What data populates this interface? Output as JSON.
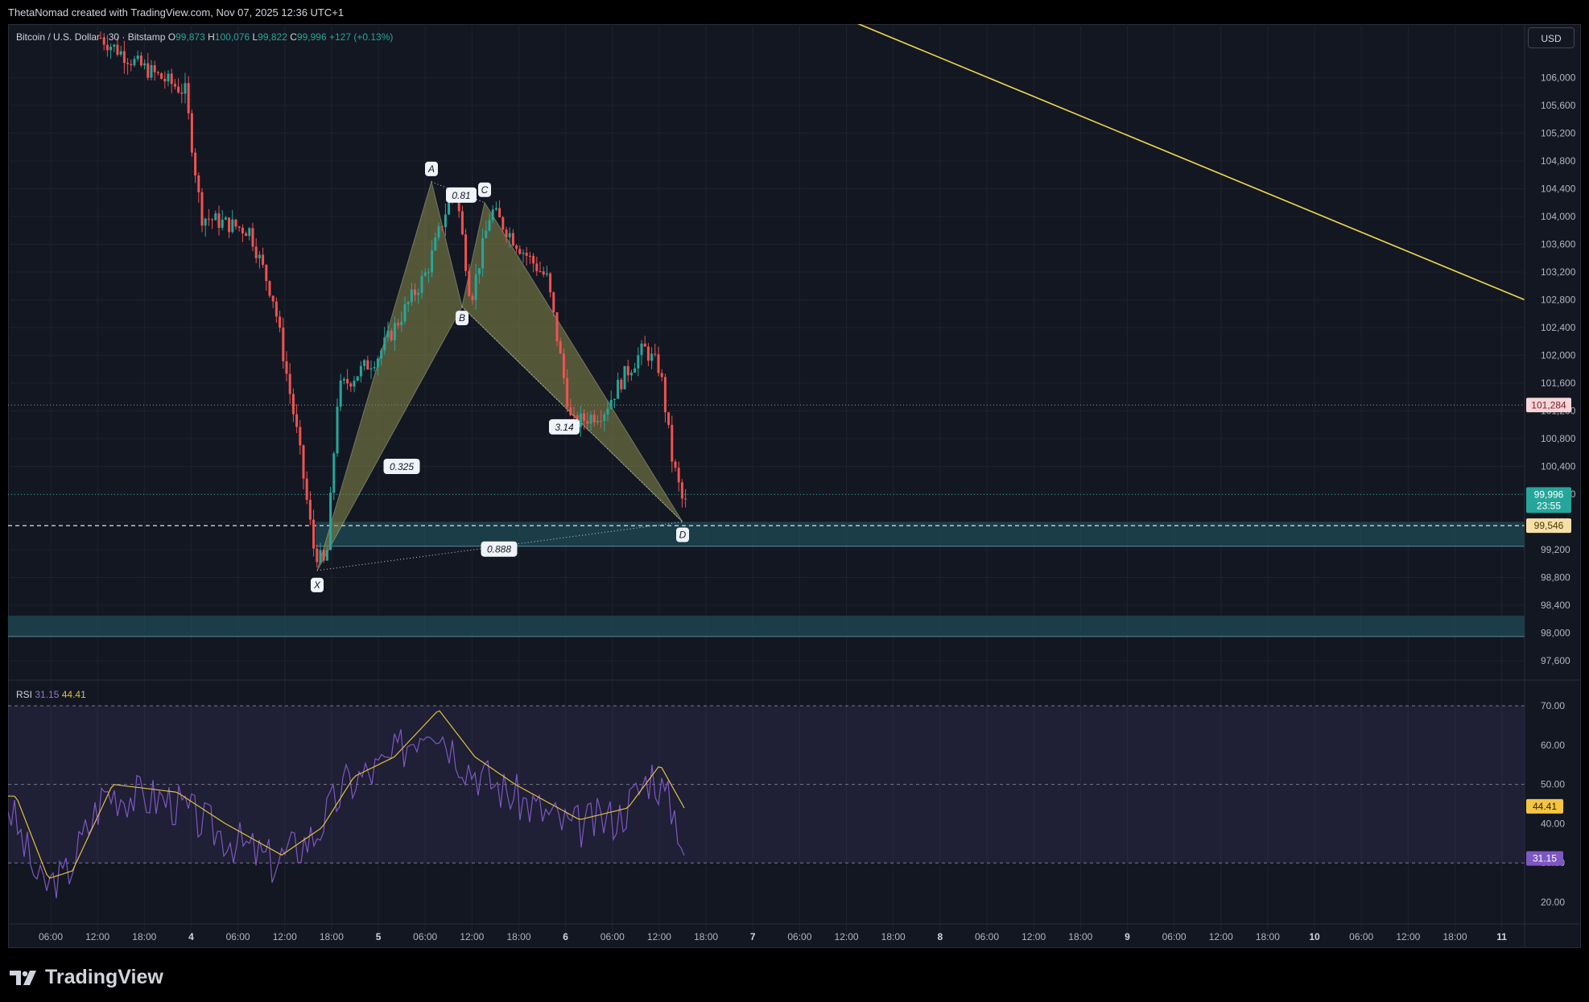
{
  "header": {
    "credit": "ThetaNomad created with TradingView.com, Nov 07, 2025 12:36 UTC+1",
    "symbol": "Bitcoin / U.S. Dollar · 30 · Bitstamp",
    "ohlc": {
      "o_label": "O",
      "o": "99,873",
      "h_label": "H",
      "h": "100,076",
      "l_label": "L",
      "l": "99,822",
      "c_label": "C",
      "c": "99,996",
      "change": "+127 (+0.13%)"
    },
    "currency": "USD"
  },
  "colors": {
    "bg": "#131722",
    "up": "#26a69a",
    "down": "#ef5350",
    "pattern_fill": "#8a8a4a",
    "trendline": "#f2d94e",
    "rsi": "#7e57c2",
    "rsi_ma": "#e0c040",
    "zone": "#1e4b55"
  },
  "chart_data": [
    {
      "type": "candlestick",
      "title": "Bitcoin / U.S. Dollar · 30 · Bitstamp",
      "y_ticks": [
        "106,000",
        "105,600",
        "105,200",
        "104,800",
        "104,400",
        "104,000",
        "103,600",
        "103,200",
        "102,800",
        "102,400",
        "102,000",
        "101,600",
        "101,200",
        "100,800",
        "100,400",
        "100,000",
        "99,600",
        "99,200",
        "98,800",
        "98,400",
        "98,000",
        "97,600"
      ],
      "ylim": [
        97350,
        106500
      ],
      "x_ticks": [
        "06:00",
        "12:00",
        "18:00",
        "4",
        "06:00",
        "12:00",
        "18:00",
        "5",
        "06:00",
        "12:00",
        "18:00",
        "6",
        "06:00",
        "12:00",
        "18:00",
        "7",
        "06:00",
        "12:00",
        "18:00",
        "8",
        "06:00",
        "12:00",
        "18:00",
        "9",
        "06:00",
        "12:00",
        "18:00",
        "10",
        "06:00",
        "12:00",
        "18:00",
        "11"
      ],
      "price_labels": {
        "marked_level": "101,284",
        "last_price": "99,996",
        "countdown": "23:55",
        "target_level": "99,546"
      },
      "harmonic_pattern": {
        "points": [
          {
            "label": "X",
            "price": 98900
          },
          {
            "label": "A",
            "price": 104500
          },
          {
            "label": "B",
            "price": 102700
          },
          {
            "label": "C",
            "price": 104200
          },
          {
            "label": "D",
            "price": 99600
          }
        ],
        "ratios": [
          "0.81",
          "0.325",
          "3.14",
          "0.888"
        ]
      },
      "zones": [
        {
          "from": 99250,
          "to": 99600
        },
        {
          "from": 97950,
          "to": 98250
        }
      ],
      "trendline": {
        "from_price": 107000,
        "to_price": 102800
      }
    },
    {
      "type": "line",
      "title": "RSI",
      "values_legend": {
        "rsi": "31.15",
        "ma": "44.41"
      },
      "y_ticks": [
        "70.00",
        "60.00",
        "50.00",
        "40.00",
        "30.00",
        "20.00"
      ],
      "ylim": [
        15,
        73
      ],
      "levels": [
        70,
        50,
        30
      ],
      "series": [
        {
          "name": "RSI",
          "last": "31.15"
        },
        {
          "name": "MA",
          "last": "44.41"
        }
      ]
    }
  ],
  "brand": {
    "name": "TradingView"
  }
}
